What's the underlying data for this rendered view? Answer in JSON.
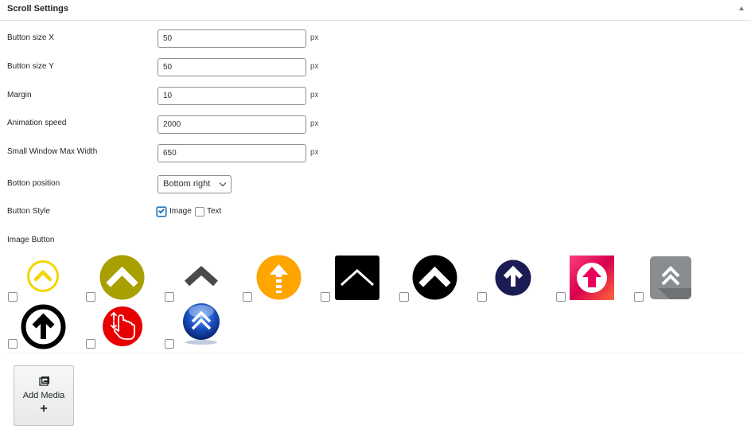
{
  "panel": {
    "title": "Scroll Settings",
    "toggle_icon": "triangle-up-icon"
  },
  "fields": [
    {
      "label": "Button size X",
      "value": "50",
      "unit": "px"
    },
    {
      "label": "Button size Y",
      "value": "50",
      "unit": "px"
    },
    {
      "label": "Margin",
      "value": "10",
      "unit": "px"
    },
    {
      "label": "Animation speed",
      "value": "2000",
      "unit": "px"
    },
    {
      "label": "Small Window Max Width",
      "value": "650",
      "unit": "px"
    }
  ],
  "position": {
    "label": "Botton position",
    "selected": "Bottom right"
  },
  "style": {
    "label": "Button Style",
    "options": [
      {
        "label": "Image",
        "checked": true
      },
      {
        "label": "Text",
        "checked": false
      }
    ]
  },
  "image_button": {
    "label": "Image Button",
    "icons": [
      {
        "name": "yellow-outline-chevron-up-icon",
        "checked": false
      },
      {
        "name": "olive-circle-chevron-up-icon",
        "checked": false
      },
      {
        "name": "gray-chevron-up-icon",
        "checked": false
      },
      {
        "name": "orange-circle-arrow-up-icon",
        "checked": false
      },
      {
        "name": "black-square-chevron-up-icon",
        "checked": false
      },
      {
        "name": "black-circle-chevron-up-icon",
        "checked": false
      },
      {
        "name": "navy-circle-arrow-up-icon",
        "checked": false
      },
      {
        "name": "pink-square-arrow-up-icon",
        "checked": false
      },
      {
        "name": "gray-double-chevron-up-icon",
        "checked": false
      },
      {
        "name": "black-ring-arrow-up-icon",
        "checked": false
      },
      {
        "name": "red-circle-hand-icon",
        "checked": false
      },
      {
        "name": "blue-globe-double-chevron-up-icon",
        "checked": false
      }
    ]
  },
  "add_media": {
    "label": "Add Media",
    "icon": "media-icon",
    "plus": "+"
  },
  "colors": {
    "accent": "#2271b1",
    "border": "#8c8f94",
    "yellow": "#f2d600",
    "olive": "#a8a000",
    "orange": "#ffa500",
    "navy": "#1c1c54",
    "pink": "#e8005a",
    "red": "#e80000"
  }
}
